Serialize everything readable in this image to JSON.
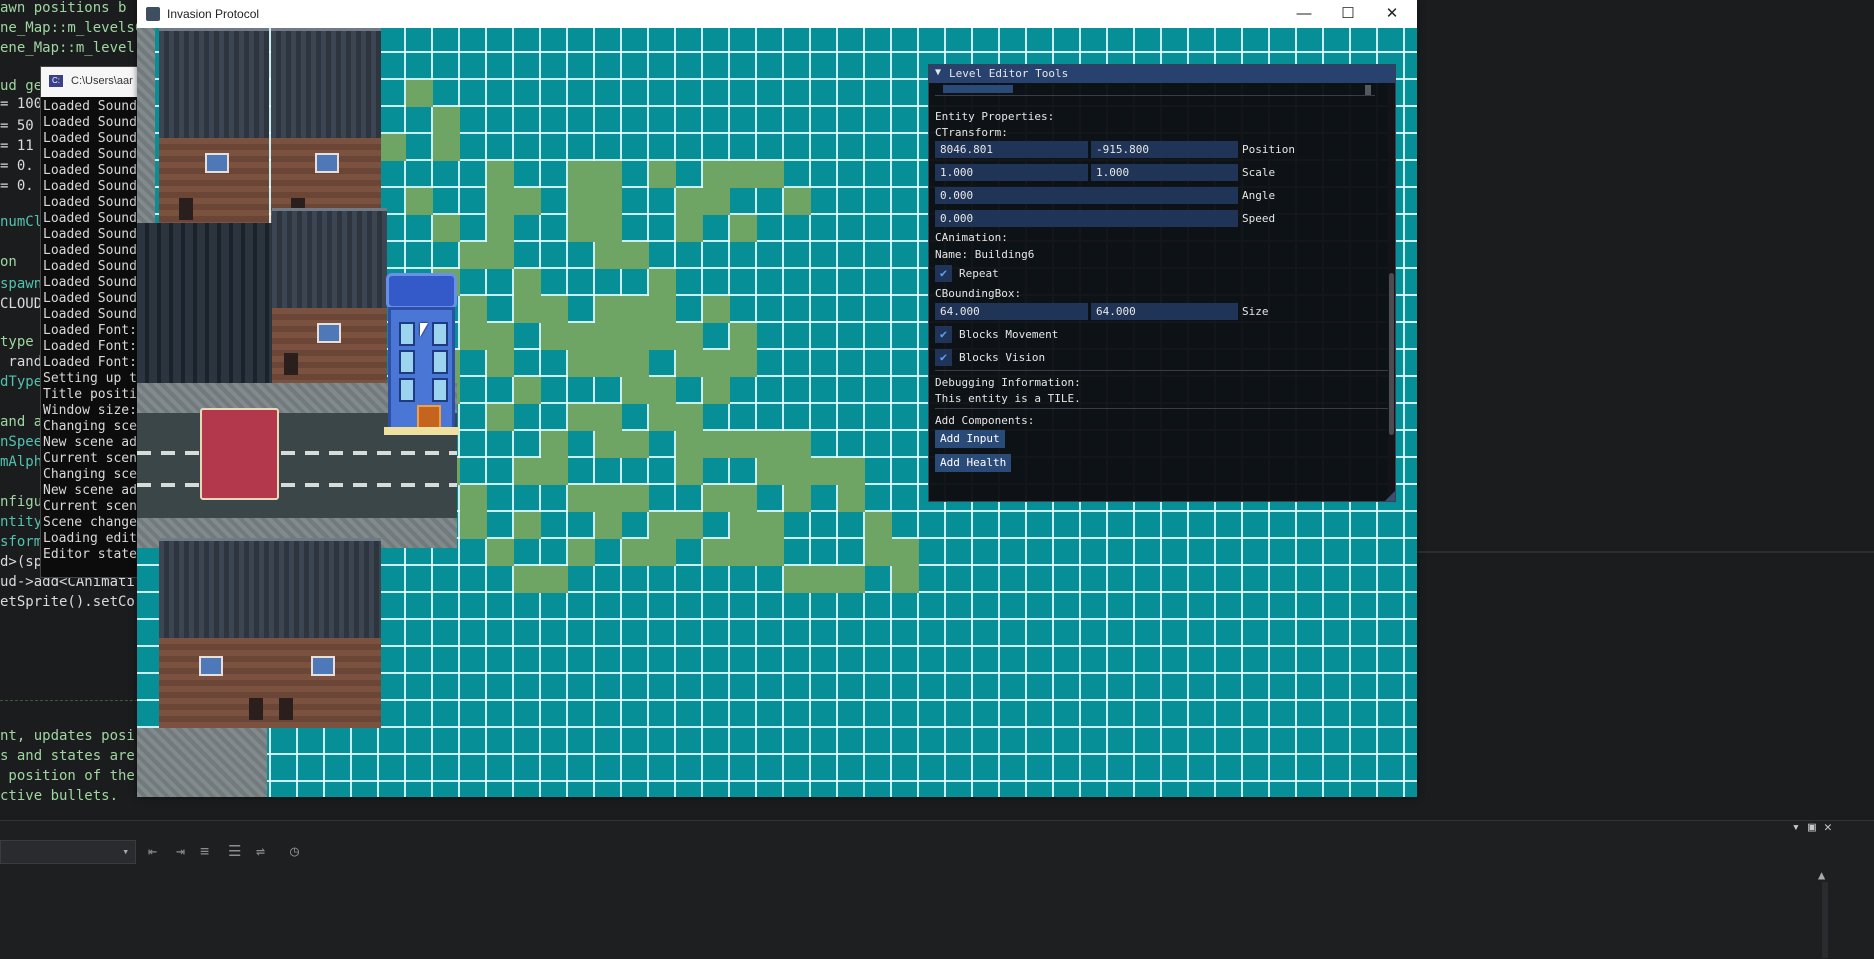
{
  "code_editor": {
    "lines": [
      {
        "text": "awn positions b",
        "color": "green"
      },
      {
        "text": "ne_Map::m_levelsC",
        "color": "green"
      },
      {
        "text": "ene_Map::m_level",
        "color": "green"
      },
      {
        "text": "ud ge",
        "color": "green"
      },
      {
        "text": "= 100",
        "color": "white"
      },
      {
        "text": "= 50",
        "color": "white"
      },
      {
        "text": "= 11",
        "color": "white"
      },
      {
        "text": "= 0.",
        "color": "white"
      },
      {
        "text": "= 0.",
        "color": "white"
      },
      {
        "text": "numCl",
        "color": "teal"
      },
      {
        "text": "on",
        "color": "green"
      },
      {
        "text": "spawn",
        "color": "teal"
      },
      {
        "text": "CLOUD",
        "color": "white"
      },
      {
        "text": "type",
        "color": "green"
      },
      {
        "text": " rand",
        "color": "white"
      },
      {
        "text": "dType",
        "color": "teal"
      },
      {
        "text": "and a",
        "color": "green"
      },
      {
        "text": "nSpee",
        "color": "teal"
      },
      {
        "text": "mAlph",
        "color": "teal"
      },
      {
        "text": "nfigu",
        "color": "green"
      },
      {
        "text": "ntity",
        "color": "teal"
      },
      {
        "text": "sform",
        "color": "teal"
      },
      {
        "text": "d>(sp",
        "color": "white"
      },
      {
        "text": "ud->add<CAnimati",
        "color": "white"
      },
      {
        "text": "etSprite().setCo",
        "color": "white"
      },
      {
        "text": "nt, updates posi",
        "color": "green"
      },
      {
        "text": "s and states are",
        "color": "green"
      },
      {
        "text": " position of the",
        "color": "green"
      },
      {
        "text": "ctive bullets.",
        "color": "green"
      }
    ]
  },
  "console": {
    "title": "C:\\Users\\aar",
    "icon": "console-icon",
    "lines": [
      "Loaded Sound",
      "Loaded Sound",
      "Loaded Sound",
      "Loaded Sound",
      "Loaded Sound",
      "Loaded Sound",
      "Loaded Sound",
      "Loaded Sound",
      "Loaded Sound",
      "Loaded Sound",
      "Loaded Sound",
      "Loaded Sound",
      "Loaded Sound",
      "Loaded Sound",
      "Loaded Font:",
      "Loaded Font:",
      "Loaded Font:",
      "Setting up t",
      "Title positi",
      "Window size:",
      "Changing sce",
      "New scene ad",
      "Current scen",
      "Changing sce",
      "New scene ad",
      "Current scen",
      "Scene change",
      "Loading edit",
      "Editor state"
    ]
  },
  "game_window": {
    "title": "Invasion Protocol",
    "icon": "app-icon",
    "minimize": "—",
    "maximize": "☐",
    "close": "✕",
    "tile_color": "#078f97",
    "grass_color": "#6fa564"
  },
  "level_editor": {
    "title": "Level Editor Tools",
    "entity_properties": "Entity Properties:",
    "ctransform": "CTransform:",
    "position_x": "8046.801",
    "position_y": "-915.800",
    "position_label": "Position",
    "scale_x": "1.000",
    "scale_y": "1.000",
    "scale_label": "Scale",
    "angle": "0.000",
    "angle_label": "Angle",
    "speed": "0.000",
    "speed_label": "Speed",
    "canimation": "CAnimation:",
    "name": "Name: Building6",
    "repeat_label": "Repeat",
    "repeat_checked": true,
    "cboundingbox": "CBoundingBox:",
    "size_x": "64.000",
    "size_y": "64.000",
    "size_label": "Size",
    "blocks_movement_label": "Blocks Movement",
    "blocks_vision_label": "Blocks Vision",
    "debugging_info": "Debugging Information:",
    "debug_text": "This entity is a TILE.",
    "add_components": "Add Components:",
    "add_input": "Add Input",
    "add_health": "Add Health",
    "check_glyph": "✔",
    "collapse_glyph": "▼"
  },
  "vs_panel": {
    "combo_arrow": "▾",
    "pin": "▾",
    "restore": "▣",
    "close": "✕",
    "scroll_up": "▲"
  }
}
